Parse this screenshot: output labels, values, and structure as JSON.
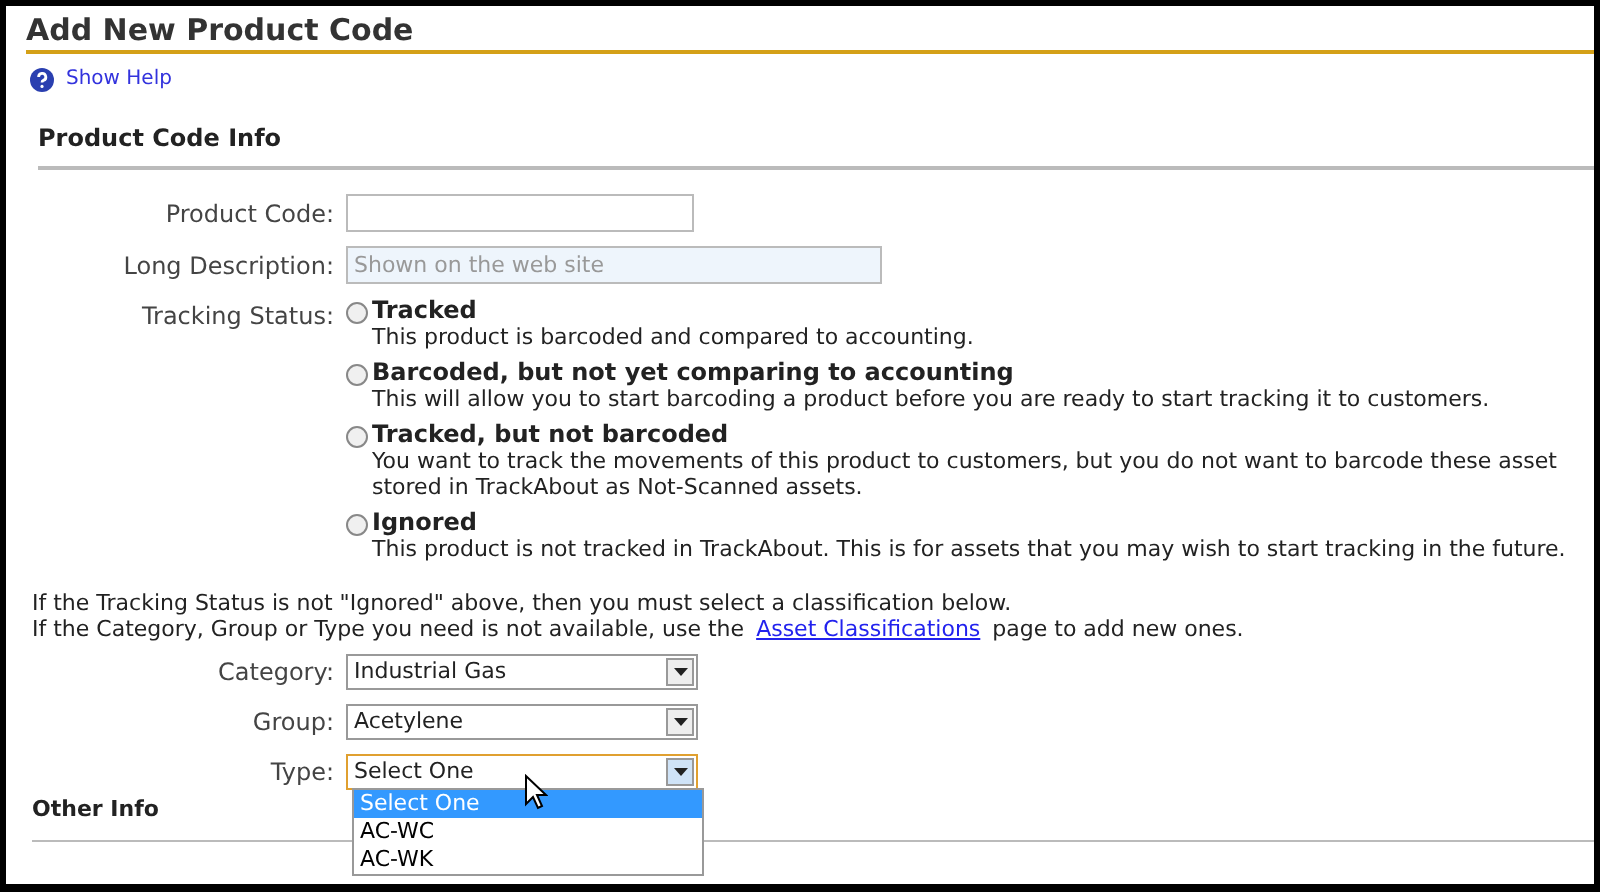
{
  "page": {
    "title": "Add New Product Code"
  },
  "help_link": "Show Help",
  "section": "Product Code Info",
  "fields": [
    {
      "label": "Product Code:"
    },
    {
      "label": "Long Description:",
      "placeholder": "Shown on the web site"
    }
  ],
  "tracking_status": {
    "label": "Tracking Status:",
    "options": [
      {
        "title": "Tracked",
        "description": "This product is barcoded and compared to accounting.",
        "selected": false
      },
      {
        "title": "Barcoded, but not yet comparing to accounting",
        "description": "This will allow you to start barcoding a product before you are ready to start tracking it to customers.",
        "selected": false
      },
      {
        "title": "Tracked, but not barcoded",
        "description": "You want to track the movements of this product to customers, but you do not want to barcode these asset",
        "description_2": "stored in TrackAbout as Not-Scanned assets.",
        "selected": false
      },
      {
        "title": "Ignored",
        "description": "This product is not tracked in TrackAbout. This is for assets that you may wish to start tracking in the future.",
        "selected": false
      }
    ]
  },
  "note_line_1": "If the Tracking Status is not \"Ignored\" above, then you must select a classification below.",
  "note_line_2": {
    "before": "If the Category, Group or Type you need is not available, use the",
    "link": "Asset Classifications",
    "after": "page to add new ones."
  },
  "selects": [
    {
      "label": "Category:",
      "value": "Industrial Gas",
      "focused": false
    },
    {
      "label": "Group:",
      "value": "Acetylene",
      "focused": false
    },
    {
      "label": "Type:",
      "value": "Select One",
      "focused": true
    }
  ],
  "type_dropdown": [
    {
      "label": "Select One",
      "selected": true
    },
    {
      "label": "AC-WC",
      "selected": false
    },
    {
      "label": "AC-WK",
      "selected": false
    }
  ],
  "section_2": "Other Info"
}
